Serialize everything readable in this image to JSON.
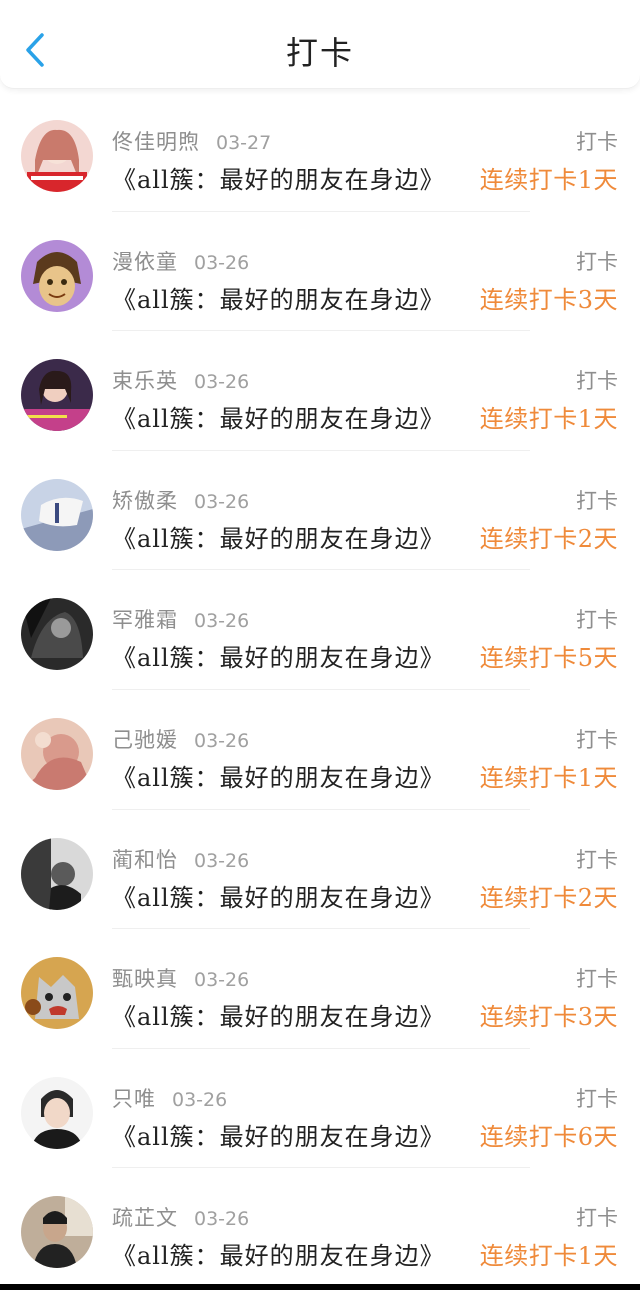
{
  "header": {
    "title": "打卡"
  },
  "colors": {
    "accent": "#2aa2e8",
    "streak": "#ef8a3a",
    "muted": "#8e8e8e"
  },
  "rows": [
    {
      "name": "佟佳明煦",
      "date": "03-27",
      "action": "打卡",
      "book": "《all簇：最好的朋友在身边》",
      "streak": "连续打卡1天"
    },
    {
      "name": "漫依童",
      "date": "03-26",
      "action": "打卡",
      "book": "《all簇：最好的朋友在身边》",
      "streak": "连续打卡3天"
    },
    {
      "name": "束乐英",
      "date": "03-26",
      "action": "打卡",
      "book": "《all簇：最好的朋友在身边》",
      "streak": "连续打卡1天"
    },
    {
      "name": "矫傲柔",
      "date": "03-26",
      "action": "打卡",
      "book": "《all簇：最好的朋友在身边》",
      "streak": "连续打卡2天"
    },
    {
      "name": "罕雅霜",
      "date": "03-26",
      "action": "打卡",
      "book": "《all簇：最好的朋友在身边》",
      "streak": "连续打卡5天"
    },
    {
      "name": "己驰媛",
      "date": "03-26",
      "action": "打卡",
      "book": "《all簇：最好的朋友在身边》",
      "streak": "连续打卡1天"
    },
    {
      "name": "蔺和怡",
      "date": "03-26",
      "action": "打卡",
      "book": "《all簇：最好的朋友在身边》",
      "streak": "连续打卡2天"
    },
    {
      "name": "甄映真",
      "date": "03-26",
      "action": "打卡",
      "book": "《all簇：最好的朋友在身边》",
      "streak": "连续打卡3天"
    },
    {
      "name": "只唯",
      "date": "03-26",
      "action": "打卡",
      "book": "《all簇：最好的朋友在身边》",
      "streak": "连续打卡6天"
    },
    {
      "name": "疏芷文",
      "date": "03-26",
      "action": "打卡",
      "book": "《all簇：最好的朋友在身边》",
      "streak": "连续打卡1天"
    }
  ]
}
